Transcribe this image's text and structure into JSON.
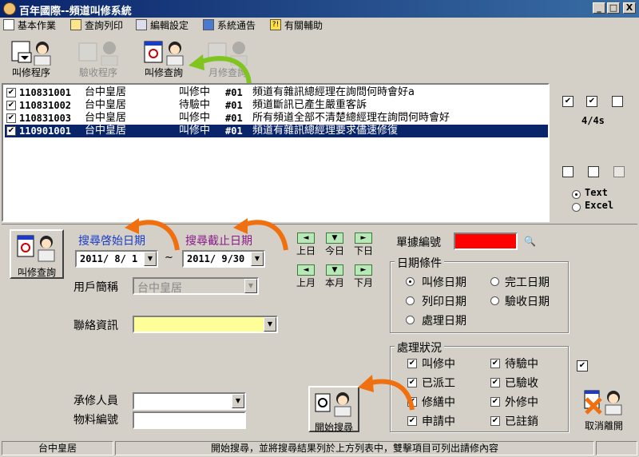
{
  "window": {
    "title": "百年國際--頻道叫修系統",
    "btn_min": "_",
    "btn_max": "□",
    "btn_close": "X"
  },
  "menu": [
    {
      "label": "基本作業",
      "icon": "document-icon"
    },
    {
      "label": "查詢列印",
      "icon": "printer-icon"
    },
    {
      "label": "編輯設定",
      "icon": "edit-icon"
    },
    {
      "label": "系統通告",
      "icon": "monitor-icon"
    },
    {
      "label": "有關輔助",
      "icon": "help-icon"
    }
  ],
  "toolbar": [
    {
      "label": "叫修程序",
      "enabled": true
    },
    {
      "label": "驗收程序",
      "enabled": false
    },
    {
      "label": "叫修查詢",
      "enabled": true
    },
    {
      "label": "月修查詢",
      "enabled": false
    }
  ],
  "list": {
    "rows": [
      {
        "checked": true,
        "id": "110831001",
        "customer": "台中皇居",
        "status": "叫修中",
        "num": "#01",
        "desc": "頻道有雜訊總經理在詢問何時會好a",
        "selected": false
      },
      {
        "checked": true,
        "id": "110831002",
        "customer": "台中皇居",
        "status": "待驗中",
        "num": "#01",
        "desc": "頻道斷訊已產生嚴重客訴",
        "selected": false
      },
      {
        "checked": true,
        "id": "110831003",
        "customer": "台中皇居",
        "status": "叫修中",
        "num": "#01",
        "desc": "所有頻道全部不清楚總經理在詢問何時會好",
        "selected": false
      },
      {
        "checked": true,
        "id": "110901001",
        "customer": "台中皇居",
        "status": "叫修中",
        "num": "#01",
        "desc": "頻道有雜訊總經理要求儘速修復",
        "selected": true
      }
    ]
  },
  "right_panel": {
    "count": "4/4s",
    "export_text": "Text",
    "export_excel": "Excel",
    "export_selected": "Text"
  },
  "query": {
    "button_label": "叫修查詢",
    "start_label": "搜尋啓始日期",
    "end_label": "搜尋截止日期",
    "start_date": "2011/ 8/ 1",
    "end_date": "2011/ 9/30",
    "tilde": "~",
    "nav": [
      "上日",
      "今日",
      "下日",
      "上月",
      "本月",
      "下月"
    ],
    "customer_label": "用戶簡稱",
    "customer_value": "台中皇居",
    "contact_label": "聯絡資訊",
    "contact_value": "",
    "repair_person_label": "承修人員",
    "repair_person_value": "",
    "material_label": "物料編號",
    "material_value": "",
    "doc_no_label": "單據編號",
    "doc_no_color": "#ff0000",
    "search_button": "開始搜尋",
    "cancel_button": "取消離開"
  },
  "date_condition": {
    "title": "日期條件",
    "options": [
      "叫修日期",
      "完工日期",
      "列印日期",
      "驗收日期",
      "處理日期"
    ],
    "selected": "叫修日期"
  },
  "process_status": {
    "title": "處理狀況",
    "options": [
      {
        "label": "叫修中",
        "checked": true
      },
      {
        "label": "待驗中",
        "checked": true
      },
      {
        "label": "已派工",
        "checked": true
      },
      {
        "label": "已驗收",
        "checked": true
      },
      {
        "label": "修繕中",
        "checked": true
      },
      {
        "label": "外修中",
        "checked": true
      },
      {
        "label": "申請中",
        "checked": true
      },
      {
        "label": "已註銷",
        "checked": true
      }
    ]
  },
  "statusbar": {
    "left": "台中皇居",
    "message": "開始搜尋，並將搜尋結果列於上方列表中，雙擊項目可列出請修內容"
  }
}
